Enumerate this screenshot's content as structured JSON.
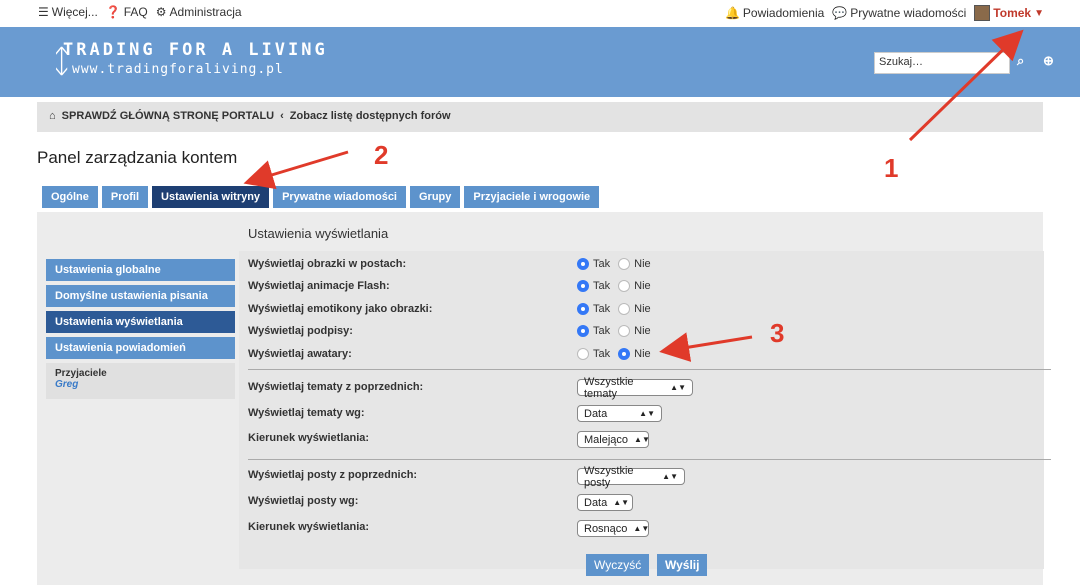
{
  "topbar": {
    "more": "Więcej...",
    "faq": "FAQ",
    "admin": "Administracja",
    "notifications": "Powiadomienia",
    "private_messages": "Prywatne wiadomości",
    "username": "Tomek"
  },
  "header": {
    "logo_title": "TRADING FOR A LIVING",
    "logo_url": "www.tradingforaliving.pl",
    "search_placeholder": "Szukaj…"
  },
  "breadcrumb": {
    "home": "SPRAWDŹ GŁÓWNĄ STRONĘ PORTALU",
    "sep": "‹",
    "forums": "Zobacz listę dostępnych forów"
  },
  "page_title": "Panel zarządzania kontem",
  "tabs": [
    {
      "label": "Ogólne"
    },
    {
      "label": "Profil"
    },
    {
      "label": "Ustawienia witryny",
      "active": true
    },
    {
      "label": "Prywatne wiadomości"
    },
    {
      "label": "Grupy"
    },
    {
      "label": "Przyjaciele i wrogowie"
    }
  ],
  "sidebar": {
    "items": [
      {
        "label": "Ustawienia globalne"
      },
      {
        "label": "Domyślne ustawienia pisania"
      },
      {
        "label": "Ustawienia wyświetlania",
        "active": true
      },
      {
        "label": "Ustawienia powiadomień"
      }
    ],
    "friends_label": "Przyjaciele",
    "friend": "Greg"
  },
  "section_title": "Ustawienia wyświetlania",
  "radio_rows": [
    {
      "label": "Wyświetlaj obrazki w postach:",
      "yes": "Tak",
      "no": "Nie",
      "value": "Tak"
    },
    {
      "label": "Wyświetlaj animacje Flash:",
      "yes": "Tak",
      "no": "Nie",
      "value": "Tak"
    },
    {
      "label": "Wyświetlaj emotikony jako obrazki:",
      "yes": "Tak",
      "no": "Nie",
      "value": "Tak"
    },
    {
      "label": "Wyświetlaj podpisy:",
      "yes": "Tak",
      "no": "Nie",
      "value": "Tak"
    },
    {
      "label": "Wyświetlaj awatary:",
      "yes": "Tak",
      "no": "Nie",
      "value": "Nie"
    }
  ],
  "topics": [
    {
      "label": "Wyświetlaj tematy z poprzednich:",
      "value": "Wszystkie tematy"
    },
    {
      "label": "Wyświetlaj tematy wg:",
      "value": "Data"
    },
    {
      "label": "Kierunek wyświetlania:",
      "value": "Malejąco"
    }
  ],
  "posts": [
    {
      "label": "Wyświetlaj posty z poprzednich:",
      "value": "Wszystkie posty"
    },
    {
      "label": "Wyświetlaj posty wg:",
      "value": "Data"
    },
    {
      "label": "Kierunek wyświetlania:",
      "value": "Rosnąco"
    }
  ],
  "buttons": {
    "reset": "Wyczyść",
    "submit": "Wyślij"
  },
  "annotations": [
    "1",
    "2",
    "3"
  ],
  "colors": {
    "accent": "#5d93cc",
    "active_tab": "#1e3f73",
    "annotation": "#e03a2a"
  }
}
